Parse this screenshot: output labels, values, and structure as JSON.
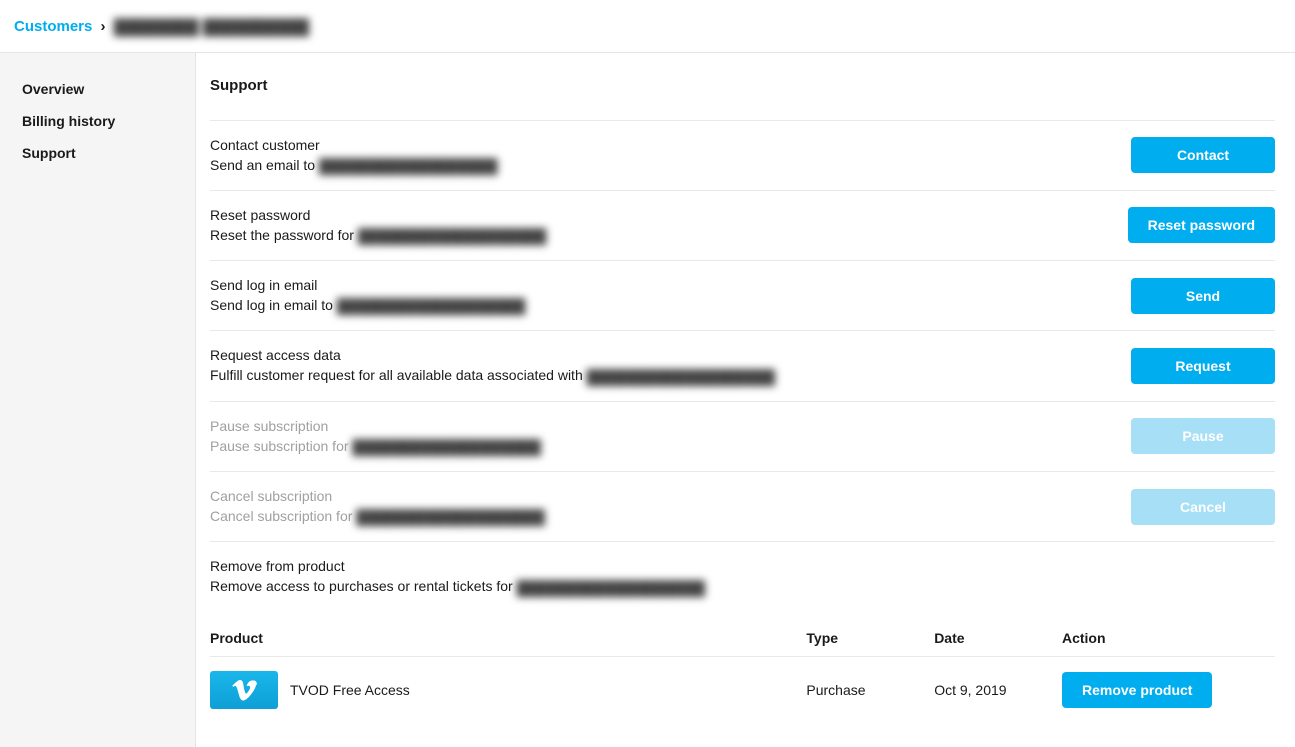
{
  "breadcrumb": {
    "root": "Customers",
    "sep": "›",
    "current": "████████ ██████████"
  },
  "sidebar": {
    "items": [
      {
        "label": "Overview"
      },
      {
        "label": "Billing history"
      },
      {
        "label": "Support"
      }
    ]
  },
  "page": {
    "title": "Support"
  },
  "actions": {
    "contact": {
      "title": "Contact customer",
      "desc_prefix": "Send an email to ",
      "desc_redacted": "██████████████████",
      "button": "Contact"
    },
    "reset": {
      "title": "Reset password",
      "desc_prefix": "Reset the password for ",
      "desc_redacted": "███████████████████",
      "button": "Reset password"
    },
    "login_email": {
      "title": "Send log in email",
      "desc_prefix": "Send log in email to ",
      "desc_redacted": "███████████████████",
      "button": "Send"
    },
    "request_data": {
      "title": "Request access data",
      "desc_prefix": "Fulfill customer request for all available data associated with ",
      "desc_redacted": "███████████████████",
      "button": "Request"
    },
    "pause": {
      "title": "Pause subscription",
      "desc_prefix": "Pause subscription for ",
      "desc_redacted": "███████████████████",
      "button": "Pause"
    },
    "cancel": {
      "title": "Cancel subscription",
      "desc_prefix": "Cancel subscription for ",
      "desc_redacted": "███████████████████",
      "button": "Cancel"
    },
    "remove": {
      "title": "Remove from product",
      "desc_prefix": "Remove access to purchases or rental tickets for ",
      "desc_redacted": "███████████████████"
    }
  },
  "table": {
    "headers": {
      "product": "Product",
      "type": "Type",
      "date": "Date",
      "action": "Action"
    },
    "rows": [
      {
        "product": "TVOD Free Access",
        "type": "Purchase",
        "date": "Oct 9, 2019",
        "action": "Remove product"
      }
    ]
  }
}
